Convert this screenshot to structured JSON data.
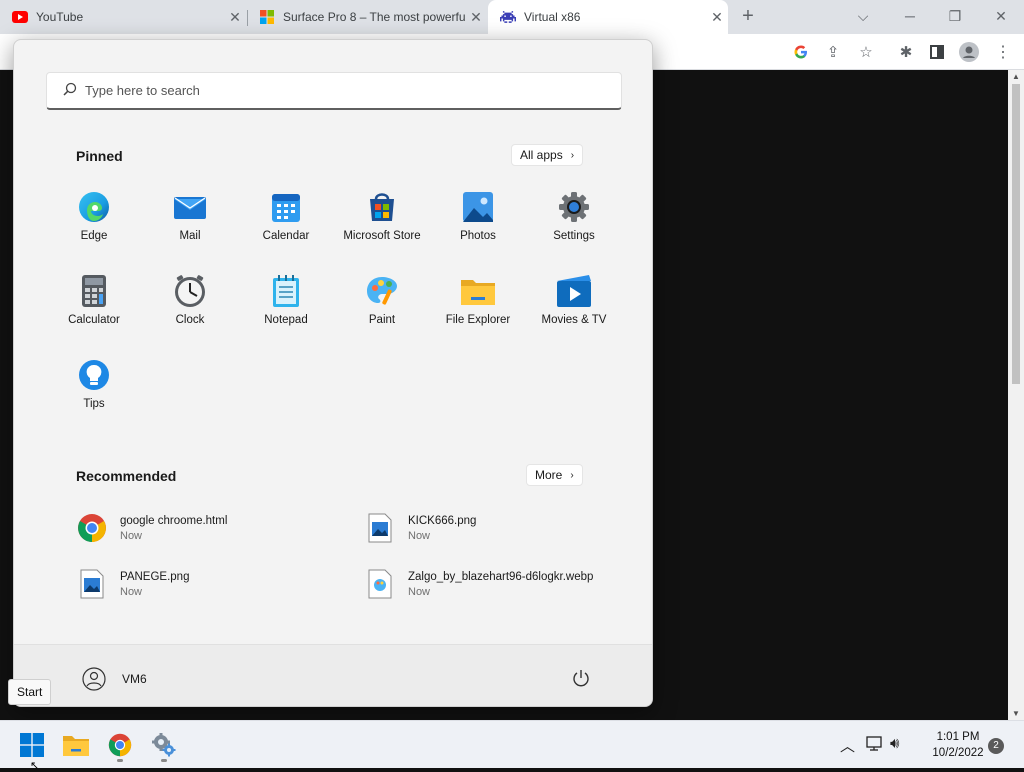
{
  "browser": {
    "tabs": [
      {
        "title": "YouTube",
        "icon": "youtube-icon",
        "active": false
      },
      {
        "title": "Surface Pro 8 – The most powerful",
        "icon": "microsoft-logo-icon",
        "active": false
      },
      {
        "title": "Virtual x86",
        "icon": "space-invader-icon",
        "active": true
      }
    ],
    "close_glyph": "✕",
    "new_tab_glyph": "+"
  },
  "start_menu": {
    "search_placeholder": "Type here to search",
    "pinned_title": "Pinned",
    "all_apps_label": "All apps",
    "pinned_apps": [
      {
        "label": "Edge",
        "icon": "edge-icon"
      },
      {
        "label": "Mail",
        "icon": "mail-icon"
      },
      {
        "label": "Calendar",
        "icon": "calendar-icon"
      },
      {
        "label": "Microsoft Store",
        "icon": "store-icon"
      },
      {
        "label": "Photos",
        "icon": "photos-icon"
      },
      {
        "label": "Settings",
        "icon": "settings-icon"
      },
      {
        "label": "Calculator",
        "icon": "calculator-icon"
      },
      {
        "label": "Clock",
        "icon": "clock-icon"
      },
      {
        "label": "Notepad",
        "icon": "notepad-icon"
      },
      {
        "label": "Paint",
        "icon": "paint-icon"
      },
      {
        "label": "File Explorer",
        "icon": "folder-icon"
      },
      {
        "label": "Movies & TV",
        "icon": "movies-icon"
      },
      {
        "label": "Tips",
        "icon": "tips-icon"
      }
    ],
    "recommended_title": "Recommended",
    "more_label": "More",
    "recommended": [
      {
        "name": "google chroome.html",
        "time": "Now",
        "icon": "chrome-file-icon"
      },
      {
        "name": "KICK666.png",
        "time": "Now",
        "icon": "image-file-icon"
      },
      {
        "name": "PANEGE.png",
        "time": "Now",
        "icon": "image-file-icon"
      },
      {
        "name": "Zalgo_by_blazehart96-d6logkr.webp",
        "time": "Now",
        "icon": "webp-file-icon"
      }
    ],
    "user_name": "VM6",
    "tooltip": "Start"
  },
  "taskbar": {
    "time": "1:01 PM",
    "date": "10/2/2022",
    "notification_count": "2"
  }
}
